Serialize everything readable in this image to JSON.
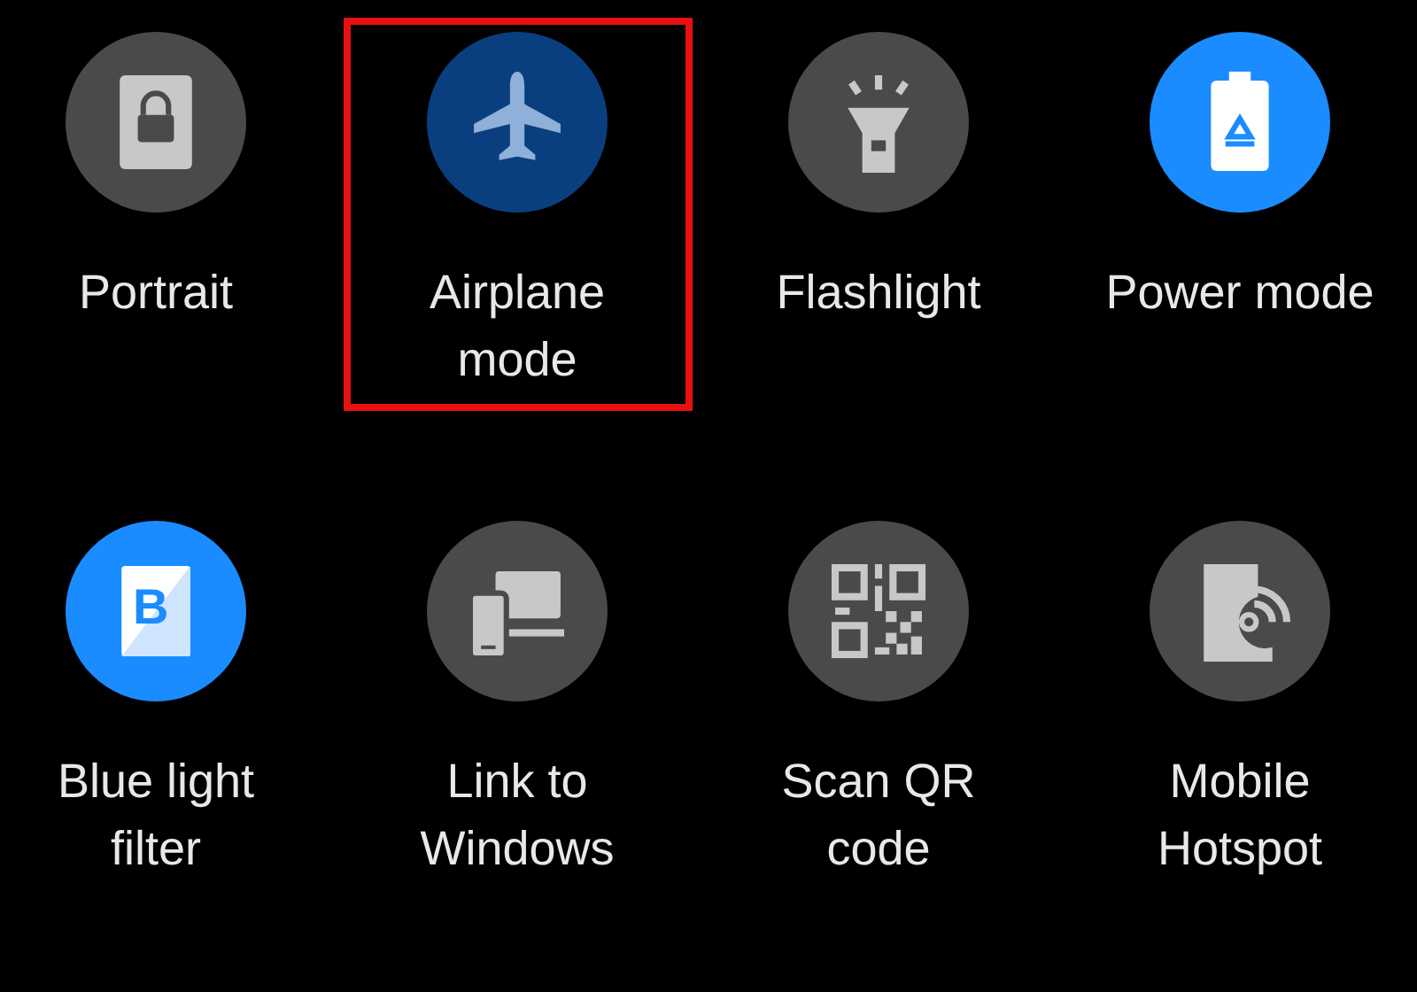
{
  "tiles": [
    {
      "kind": "portrait",
      "label": "Portrait",
      "color": "#4a4a4a",
      "highlighted": false
    },
    {
      "kind": "airplane",
      "label": "Airplane mode",
      "color": "#0a3f7f",
      "highlighted": true
    },
    {
      "kind": "flashlight",
      "label": "Flashlight",
      "color": "#4a4a4a",
      "highlighted": false
    },
    {
      "kind": "power",
      "label": "Power mode",
      "color": "#1a8cff",
      "highlighted": false
    },
    {
      "kind": "bluelight",
      "label": "Blue light filter",
      "color": "#1a8cff",
      "highlighted": false,
      "glyph": "B"
    },
    {
      "kind": "link",
      "label": "Link to Windows",
      "color": "#4a4a4a",
      "highlighted": false
    },
    {
      "kind": "qr",
      "label": "Scan QR code",
      "color": "#4a4a4a",
      "highlighted": false
    },
    {
      "kind": "hotspot",
      "label": "Mobile Hotspot",
      "color": "#4a4a4a",
      "highlighted": false
    }
  ]
}
